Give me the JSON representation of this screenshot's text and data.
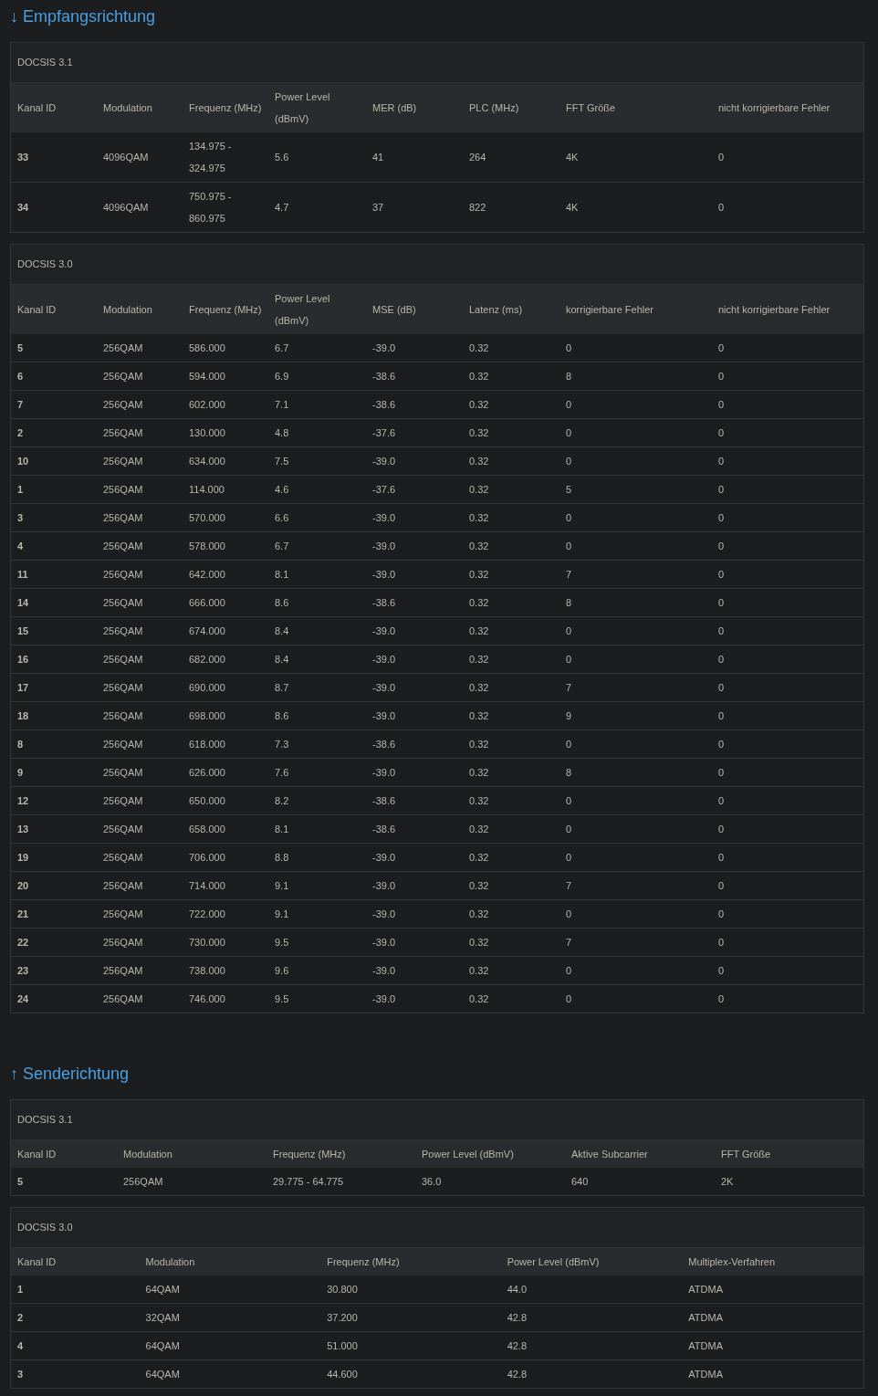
{
  "sections": [
    {
      "title": "↓ Empfangsrichtung",
      "tables": [
        {
          "caption": "DOCSIS 3.1",
          "columns": [
            "Kanal ID",
            "Modulation",
            "Frequenz (MHz)",
            "Power Level (dBmV)",
            "MER (dB)",
            "PLC (MHz)",
            "FFT Größe",
            "nicht korrigierbare Fehler"
          ],
          "rows": [
            [
              "33",
              "4096QAM",
              "134.975 - 324.975",
              "5.6",
              "41",
              "264",
              "4K",
              "0"
            ],
            [
              "34",
              "4096QAM",
              "750.975 - 860.975",
              "4.7",
              "37",
              "822",
              "4K",
              "0"
            ]
          ]
        },
        {
          "caption": "DOCSIS 3.0",
          "columns": [
            "Kanal ID",
            "Modulation",
            "Frequenz (MHz)",
            "Power Level (dBmV)",
            "MSE (dB)",
            "Latenz (ms)",
            "korrigierbare Fehler",
            "nicht korrigierbare Fehler"
          ],
          "rows": [
            [
              "5",
              "256QAM",
              "586.000",
              "6.7",
              "-39.0",
              "0.32",
              "0",
              "0"
            ],
            [
              "6",
              "256QAM",
              "594.000",
              "6.9",
              "-38.6",
              "0.32",
              "8",
              "0"
            ],
            [
              "7",
              "256QAM",
              "602.000",
              "7.1",
              "-38.6",
              "0.32",
              "0",
              "0"
            ],
            [
              "2",
              "256QAM",
              "130.000",
              "4.8",
              "-37.6",
              "0.32",
              "0",
              "0"
            ],
            [
              "10",
              "256QAM",
              "634.000",
              "7.5",
              "-39.0",
              "0.32",
              "0",
              "0"
            ],
            [
              "1",
              "256QAM",
              "114.000",
              "4.6",
              "-37.6",
              "0.32",
              "5",
              "0"
            ],
            [
              "3",
              "256QAM",
              "570.000",
              "6.6",
              "-39.0",
              "0.32",
              "0",
              "0"
            ],
            [
              "4",
              "256QAM",
              "578.000",
              "6.7",
              "-39.0",
              "0.32",
              "0",
              "0"
            ],
            [
              "11",
              "256QAM",
              "642.000",
              "8.1",
              "-39.0",
              "0.32",
              "7",
              "0"
            ],
            [
              "14",
              "256QAM",
              "666.000",
              "8.6",
              "-38.6",
              "0.32",
              "8",
              "0"
            ],
            [
              "15",
              "256QAM",
              "674.000",
              "8.4",
              "-39.0",
              "0.32",
              "0",
              "0"
            ],
            [
              "16",
              "256QAM",
              "682.000",
              "8.4",
              "-39.0",
              "0.32",
              "0",
              "0"
            ],
            [
              "17",
              "256QAM",
              "690.000",
              "8.7",
              "-39.0",
              "0.32",
              "7",
              "0"
            ],
            [
              "18",
              "256QAM",
              "698.000",
              "8.6",
              "-39.0",
              "0.32",
              "9",
              "0"
            ],
            [
              "8",
              "256QAM",
              "618.000",
              "7.3",
              "-38.6",
              "0.32",
              "0",
              "0"
            ],
            [
              "9",
              "256QAM",
              "626.000",
              "7.6",
              "-39.0",
              "0.32",
              "8",
              "0"
            ],
            [
              "12",
              "256QAM",
              "650.000",
              "8.2",
              "-38.6",
              "0.32",
              "0",
              "0"
            ],
            [
              "13",
              "256QAM",
              "658.000",
              "8.1",
              "-38.6",
              "0.32",
              "0",
              "0"
            ],
            [
              "19",
              "256QAM",
              "706.000",
              "8.8",
              "-39.0",
              "0.32",
              "0",
              "0"
            ],
            [
              "20",
              "256QAM",
              "714.000",
              "9.1",
              "-39.0",
              "0.32",
              "7",
              "0"
            ],
            [
              "21",
              "256QAM",
              "722.000",
              "9.1",
              "-39.0",
              "0.32",
              "0",
              "0"
            ],
            [
              "22",
              "256QAM",
              "730.000",
              "9.5",
              "-39.0",
              "0.32",
              "7",
              "0"
            ],
            [
              "23",
              "256QAM",
              "738.000",
              "9.6",
              "-39.0",
              "0.32",
              "0",
              "0"
            ],
            [
              "24",
              "256QAM",
              "746.000",
              "9.5",
              "-39.0",
              "0.32",
              "0",
              "0"
            ]
          ]
        }
      ]
    },
    {
      "title": "↑ Senderichtung",
      "tables": [
        {
          "caption": "DOCSIS 3.1",
          "columns": [
            "Kanal ID",
            "Modulation",
            "Frequenz (MHz)",
            "Power Level (dBmV)",
            "Aktive Subcarrier",
            "FFT Größe"
          ],
          "rows": [
            [
              "5",
              "256QAM",
              "29.775 - 64.775",
              "36.0",
              "640",
              "2K"
            ]
          ]
        },
        {
          "caption": "DOCSIS 3.0",
          "columns": [
            "Kanal ID",
            "Modulation",
            "Frequenz (MHz)",
            "Power Level (dBmV)",
            "Multiplex-Verfahren"
          ],
          "rows": [
            [
              "1",
              "64QAM",
              "30.800",
              "44.0",
              "ATDMA"
            ],
            [
              "2",
              "32QAM",
              "37.200",
              "42.8",
              "ATDMA"
            ],
            [
              "4",
              "64QAM",
              "51.000",
              "42.8",
              "ATDMA"
            ],
            [
              "3",
              "64QAM",
              "44.600",
              "42.8",
              "ATDMA"
            ]
          ]
        }
      ]
    }
  ]
}
